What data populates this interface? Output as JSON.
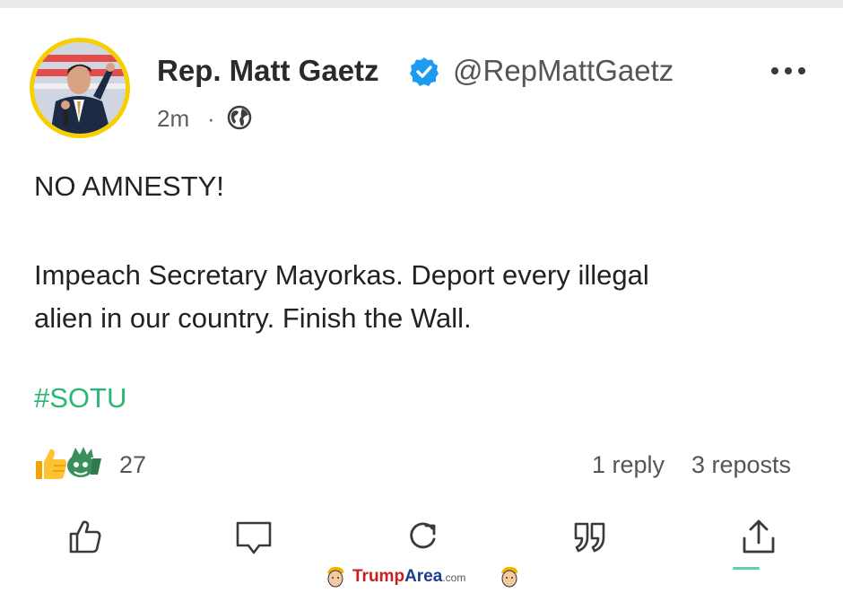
{
  "post": {
    "author_name": "Rep. Matt Gaetz",
    "handle": "@RepMattGaetz",
    "time": "2m",
    "separator": "·",
    "visibility_icon": "globe-icon",
    "body_line_1": "NO AMNESTY!",
    "body_line_2": "Impeach Secretary Mayorkas. Deport every illegal",
    "body_line_3": "alien in our country. Finish the Wall.",
    "hashtag": "#SOTU"
  },
  "stats": {
    "reaction_count": "27",
    "replies": "1 reply",
    "reposts": "3 reposts"
  },
  "actions": [
    "like-icon",
    "comment-icon",
    "repost-icon",
    "quote-icon",
    "share-icon"
  ],
  "colors": {
    "hashtag": "#2bb673",
    "verified": "#1d9bf0",
    "avatar_ring": "#f6cf00"
  },
  "watermark": {
    "part1": "Trump",
    "part2": "Area",
    "part3": ".com"
  }
}
